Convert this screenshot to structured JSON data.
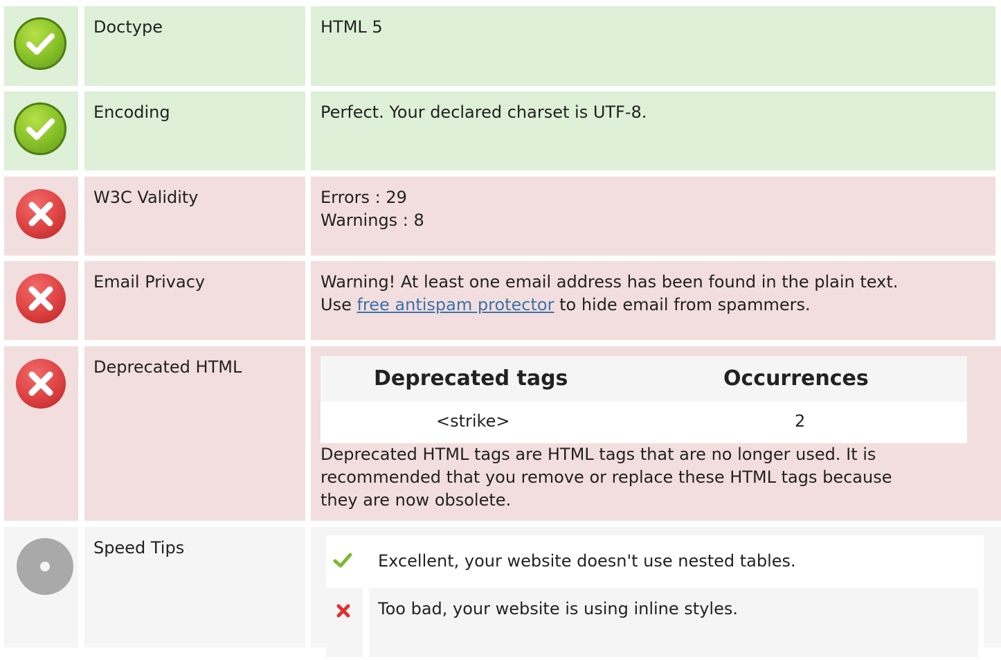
{
  "colors": {
    "ok_bg": "#def0d8",
    "bad_bg": "#f2dede",
    "neutral_bg": "#f5f5f5",
    "link": "#3c72a8"
  },
  "rows": {
    "doctype": {
      "label": "Doctype",
      "value": "HTML 5",
      "status": "ok"
    },
    "encoding": {
      "label": "Encoding",
      "value": "Perfect. Your declared charset is UTF-8.",
      "status": "ok"
    },
    "w3c": {
      "label": "W3C Validity",
      "errors": "Errors : 29",
      "warnings": "Warnings : 8",
      "status": "bad"
    },
    "email": {
      "label": "Email Privacy",
      "line1": "Warning! At least one email address has been found in the plain text.",
      "line2_prefix": "Use ",
      "link_text": "free antispam protector",
      "line2_suffix": " to hide email from spammers.",
      "status": "bad"
    },
    "deprecated": {
      "label": "Deprecated HTML",
      "table_headers": [
        "Deprecated tags",
        "Occurrences"
      ],
      "table_rows": [
        {
          "tag": "<strike>",
          "count": "2"
        }
      ],
      "description_lines": [
        "Deprecated HTML tags are HTML tags that are no longer used. It is",
        "recommended that you remove or replace these HTML tags because",
        "they are now obsolete."
      ],
      "status": "bad"
    },
    "speed": {
      "label": "Speed Tips",
      "tips": [
        {
          "text": "Excellent, your website doesn't use nested tables.",
          "status": "ok",
          "icon": "check-icon"
        },
        {
          "text": "Too bad, your website is using inline styles.",
          "status": "bad",
          "icon": "cross-icon"
        }
      ],
      "status": "neutral"
    }
  }
}
